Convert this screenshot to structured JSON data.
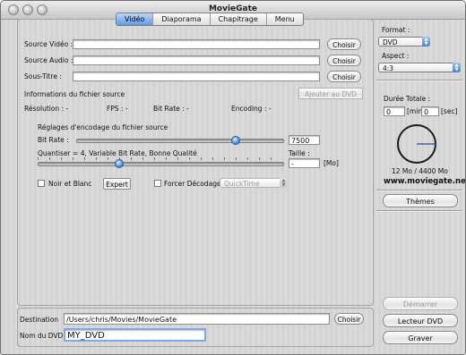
{
  "window": {
    "title": "MovieGate"
  },
  "tabs": [
    "Vidéo",
    "Diaporama",
    "Chapitrage",
    "Menu"
  ],
  "source": {
    "video_label": "Source Vidéo :",
    "audio_label": "Source Audio :",
    "subtitle_label": "Sous-Titre :",
    "video_value": "",
    "audio_value": "",
    "subtitle_value": "",
    "choose": "Choisir"
  },
  "info": {
    "title": "Informations du fichier source",
    "add_button": "Ajouter au DVD",
    "resolution": "Résolution : -",
    "fps": "FPS : -",
    "bitrate": "Bit Rate : -",
    "encoding": "Encoding : -"
  },
  "encoding": {
    "title": "Réglages d'encodage du fichier source",
    "bitrate_label": "Bit Rate :",
    "bitrate_value": "7500",
    "bitrate_fraction": 0.77,
    "quantiser_label": "Quantiser = 4, Variable Bit Rate, Bonne Qualité",
    "quantiser_fraction": 0.33,
    "size_label": "Taille :",
    "size_value": "-",
    "size_unit": "[Mo]",
    "bw_label": "Noir et Blanc",
    "expert_button": "Expert",
    "force_label": "Forcer Décodage",
    "decoder_value": "QuickTime"
  },
  "destination": {
    "label": "Destination",
    "path": "/Users/chris/Movies/MovieGate",
    "choose": "Choisir",
    "dvd_name_label": "Nom du DVD",
    "dvd_name_value": "MY_DVD"
  },
  "side": {
    "format_label": "Format :",
    "format_value": "DVD",
    "aspect_label": "Aspect :",
    "aspect_value": "4:3",
    "duration_label": "Durée Totale :",
    "minutes_value": "0",
    "minutes_unit": "[min]",
    "seconds_value": "0",
    "seconds_unit": "[sec]",
    "capacity": "12 Mo / 4400 Mo",
    "website": "www.moviegate.net",
    "themes_button": "Thèmes",
    "start_button": "Démarrer",
    "player_button": "Lecteur DVD",
    "burn_button": "Graver"
  },
  "colors": {
    "accent": "#3d7fd9",
    "gauge_hand": "#1f4fa3"
  }
}
